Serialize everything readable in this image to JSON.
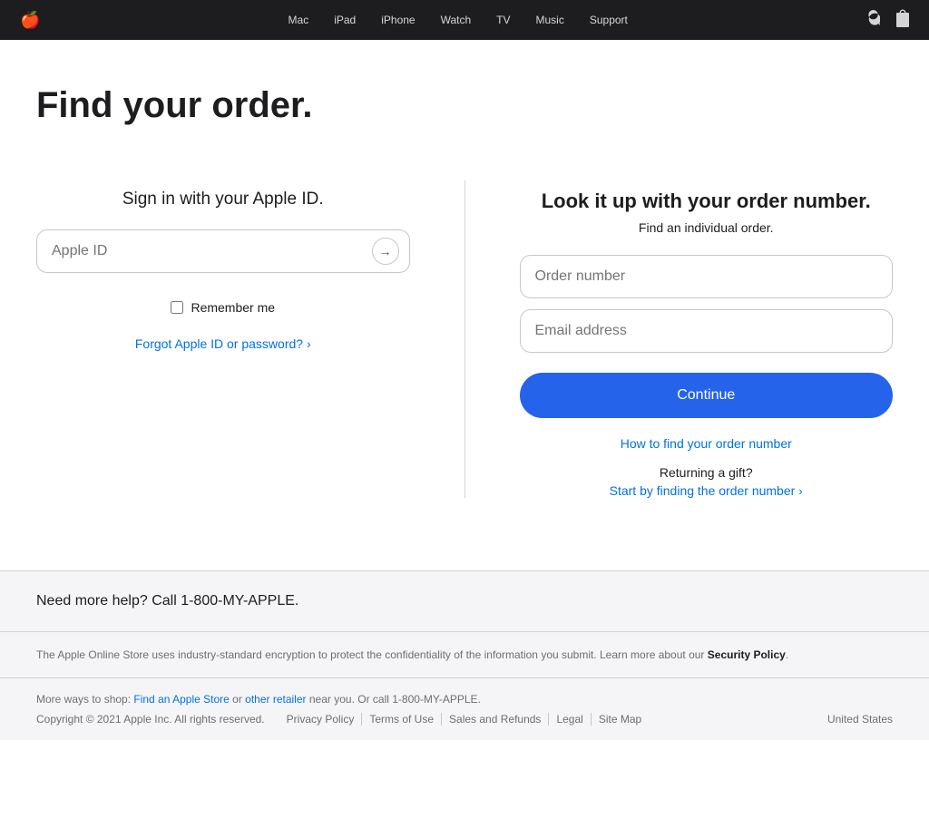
{
  "nav": {
    "logo": "🍎",
    "items": [
      {
        "label": "Mac",
        "id": "mac"
      },
      {
        "label": "iPad",
        "id": "ipad"
      },
      {
        "label": "iPhone",
        "id": "iphone"
      },
      {
        "label": "Watch",
        "id": "watch"
      },
      {
        "label": "TV",
        "id": "tv"
      },
      {
        "label": "Music",
        "id": "music"
      },
      {
        "label": "Support",
        "id": "support"
      }
    ],
    "search_icon": "🔍",
    "bag_icon": "🛍"
  },
  "page": {
    "title": "Find your order."
  },
  "left_column": {
    "heading": "Sign in with your Apple ID.",
    "apple_id_placeholder": "Apple ID",
    "remember_me_label": "Remember me",
    "forgot_link_text": "Forgot Apple ID or password? ›"
  },
  "right_column": {
    "heading": "Look it up with your order number.",
    "subtitle": "Find an individual order.",
    "order_number_placeholder": "Order number",
    "email_placeholder": "Email address",
    "continue_button": "Continue",
    "how_to_link": "How to find your order number",
    "returning_gift_text": "Returning a gift?",
    "start_finding_link": "Start by finding the order number ›"
  },
  "help_bar": {
    "text": "Need more help? Call 1-800-MY-APPLE."
  },
  "security_notice": {
    "text": "The Apple Online Store uses industry-standard encryption to protect the confidentiality of the information you submit. Learn more about our",
    "link_text": "Security Policy",
    "end": "."
  },
  "footer": {
    "more_ways_text": "More ways to shop:",
    "find_store_link": "Find an Apple Store",
    "or_text": "or",
    "other_retailer_link": "other retailer",
    "near_you_text": "near you. Or call 1-800-MY-APPLE.",
    "copyright": "Copyright © 2021 Apple Inc. All rights reserved.",
    "links": [
      {
        "label": "Privacy Policy",
        "id": "privacy-policy"
      },
      {
        "label": "Terms of Use",
        "id": "terms-of-use"
      },
      {
        "label": "Sales and Refunds",
        "id": "sales-refunds"
      },
      {
        "label": "Legal",
        "id": "legal"
      },
      {
        "label": "Site Map",
        "id": "site-map"
      }
    ],
    "region": "United States"
  }
}
